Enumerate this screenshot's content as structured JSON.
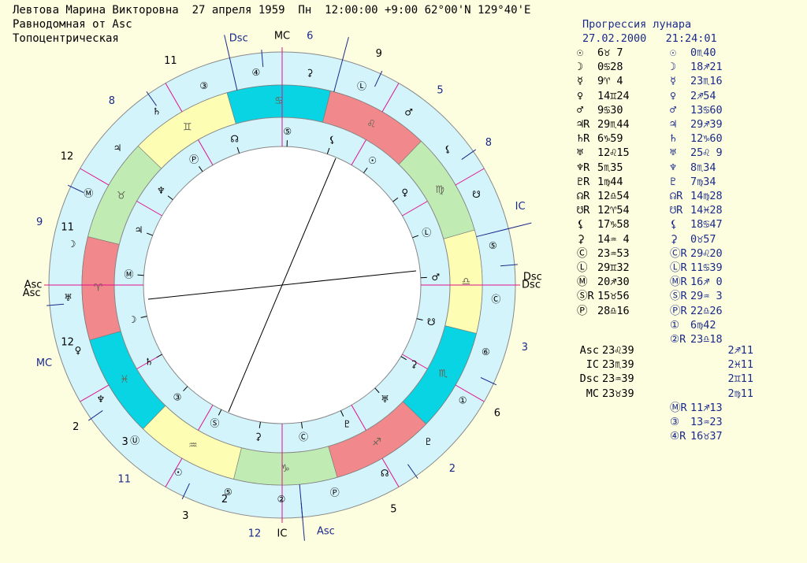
{
  "header": {
    "line1": "Левтова Марина Викторовна  27 апреля 1959  Пн  12:00:00 +9:00 62°00'N 129°40'E",
    "line2": "Равнодомная от Asc",
    "line3": "Топоцентрическая"
  },
  "panel": {
    "title": "Прогрессия лунара",
    "datetime": "27.02.2000   21:24:01",
    "planet_rows": [
      {
        "g1": "☉",
        "v1": "6♉ 7",
        "g2": "☉",
        "v2": "0♏40"
      },
      {
        "g1": "☽",
        "v1": "0♋28",
        "g2": "☽",
        "v2": "18♐21"
      },
      {
        "g1": "☿",
        "v1": "9♈ 4",
        "g2": "☿",
        "v2": "23♏16"
      },
      {
        "g1": "♀",
        "v1": "14♊24",
        "g2": "♀",
        "v2": "2♐54"
      },
      {
        "g1": "♂",
        "v1": "9♋30",
        "g2": "♂",
        "v2": "13♋60"
      },
      {
        "g1": "♃R",
        "v1": "29♏44",
        "g2": "♃",
        "v2": "29♐39"
      },
      {
        "g1": "♄R",
        "v1": "6♑59",
        "g2": "♄",
        "v2": "12♑60"
      },
      {
        "g1": "♅",
        "v1": "12♌15",
        "g2": "♅",
        "v2": "25♌ 9"
      },
      {
        "g1": "♆R",
        "v1": "5♏35",
        "g2": "♆",
        "v2": "8♏34"
      },
      {
        "g1": "♇R",
        "v1": "1♍44",
        "g2": "♇",
        "v2": "7♍34"
      },
      {
        "g1": "☊R",
        "v1": "12♎54",
        "g2": "☊R",
        "v2": "14♍28"
      },
      {
        "g1": "☋R",
        "v1": "12♈54",
        "g2": "☋R",
        "v2": "14♓28"
      },
      {
        "g1": "⚸",
        "v1": "17♑58",
        "g2": "⚸",
        "v2": "18♋47"
      },
      {
        "g1": "⚳",
        "v1": "14♒ 4",
        "g2": "⚳",
        "v2": "0♉57"
      },
      {
        "g1": "Ⓒ",
        "v1": "23♒53",
        "g2": "ⒸR",
        "v2": "29♌20"
      },
      {
        "g1": "Ⓛ",
        "v1": "29♊32",
        "g2": "ⓁR",
        "v2": "11♋39"
      },
      {
        "g1": "Ⓜ",
        "v1": "20♐30",
        "g2": "ⓂR",
        "v2": "16♐ 0"
      },
      {
        "g1": "ⓈR",
        "v1": "15♉56",
        "g2": "ⓈR",
        "v2": "29♒ 3"
      },
      {
        "g1": "Ⓟ",
        "v1": "28♎16",
        "g2": "ⓅR",
        "v2": "22♎26"
      },
      {
        "g1": "",
        "v1": "",
        "g2": "①",
        "v2": "6♍42"
      },
      {
        "g1": "",
        "v1": "",
        "g2": "②R",
        "v2": "23♎18"
      }
    ],
    "angle_rows": [
      {
        "label": "Asc",
        "v1": "23♌39",
        "v2": "2♐11"
      },
      {
        "label": "IC",
        "v1": "23♏39",
        "v2": "2♓11"
      },
      {
        "label": "Dsc",
        "v1": "23♒39",
        "v2": "2♊11"
      },
      {
        "label": "MC",
        "v1": "23♉39",
        "v2": "2♍11"
      }
    ],
    "extra_rows": [
      {
        "g2": "ⓂR",
        "v2": "11♐13"
      },
      {
        "g2": "③",
        "v2": "13♒23"
      },
      {
        "g2": "④R",
        "v2": "16♉37"
      }
    ]
  },
  "wheel": {
    "colors": {
      "fire": "#f0888c",
      "earth": "#c0ecb4",
      "air": "#fdfdb4",
      "water": "#08d4e4",
      "band": "#d4f4fc",
      "cusp": "#e0108c",
      "inner": "#ffffff",
      "label": "#1a2a8a"
    },
    "signs": [
      {
        "glyph": "♋",
        "element": "water"
      },
      {
        "glyph": "♊",
        "element": "air"
      },
      {
        "glyph": "♉",
        "element": "earth"
      },
      {
        "glyph": "♈",
        "element": "fire"
      },
      {
        "glyph": "♓",
        "element": "water"
      },
      {
        "glyph": "♒",
        "element": "air"
      },
      {
        "glyph": "♑",
        "element": "earth"
      },
      {
        "glyph": "♐",
        "element": "fire"
      },
      {
        "glyph": "♏",
        "element": "water"
      },
      {
        "glyph": "♎",
        "element": "air"
      },
      {
        "glyph": "♍",
        "element": "earth"
      },
      {
        "glyph": "♌",
        "element": "fire"
      }
    ],
    "natal_houses": [
      "12",
      "11",
      "",
      "",
      "",
      "",
      "",
      "",
      "",
      "",
      "2",
      "3"
    ],
    "axis_labels": {
      "top": "MC",
      "bottom": "IC",
      "left": "Asc",
      "right": "Dsc"
    },
    "outer_labels": [
      {
        "t": "Dsc",
        "c": "label"
      },
      {
        "t": "6",
        "c": "label"
      },
      {
        "t": "9",
        "c": "plain"
      },
      {
        "t": "5",
        "c": "label"
      },
      {
        "t": "8",
        "c": "label"
      },
      {
        "t": "IC",
        "c": "label"
      },
      {
        "t": "Dsc",
        "c": "plain"
      },
      {
        "t": "3",
        "c": "label"
      },
      {
        "t": "6",
        "c": "plain"
      },
      {
        "t": "2",
        "c": "label"
      },
      {
        "t": "5",
        "c": "plain"
      },
      {
        "t": "Asc",
        "c": "label"
      },
      {
        "t": "12",
        "c": "label"
      },
      {
        "t": "3",
        "c": "plain"
      },
      {
        "t": "11",
        "c": "label"
      },
      {
        "t": "2",
        "c": "plain"
      },
      {
        "t": "MC",
        "c": "label"
      },
      {
        "t": "Asc",
        "c": "plain"
      },
      {
        "t": "9",
        "c": "label"
      },
      {
        "t": "12",
        "c": "plain"
      },
      {
        "t": "8",
        "c": "label"
      },
      {
        "t": "11",
        "c": "plain"
      }
    ],
    "natal_glyphs": [
      "⑤",
      "⚸",
      "☉",
      "♀",
      "Ⓛ",
      "♂",
      "☋",
      "⚳",
      "♅",
      "♇",
      "Ⓒ",
      "⚳",
      "Ⓢ",
      "③",
      "♄",
      "☽",
      "Ⓜ",
      "♃",
      "♆",
      "Ⓟ",
      "☊"
    ],
    "prog_glyphs": [
      "④",
      "⚳",
      "Ⓛ",
      "♂",
      "⚸",
      "☋",
      "⑤",
      "Ⓒ",
      "⑥",
      "①",
      "♇",
      "☊",
      "Ⓟ",
      "②",
      "⑤",
      "☉",
      "Ⓤ",
      "♆",
      "♀",
      "♅",
      "☽",
      "Ⓜ",
      "♃",
      "♄",
      "③"
    ]
  }
}
